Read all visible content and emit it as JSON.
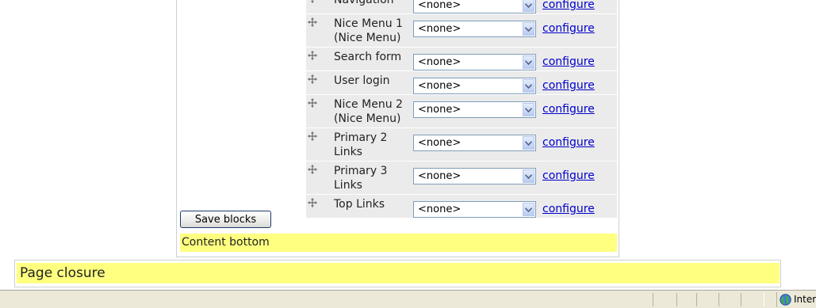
{
  "blocks": [
    {
      "name": "Navigation",
      "region": "<none>",
      "link": "configure"
    },
    {
      "name": "Nice Menu 1 (Nice Menu)",
      "region": "<none>",
      "link": "configure"
    },
    {
      "name": "Search form",
      "region": "<none>",
      "link": "configure"
    },
    {
      "name": "User login",
      "region": "<none>",
      "link": "configure"
    },
    {
      "name": "Nice Menu 2 (Nice Menu)",
      "region": "<none>",
      "link": "configure"
    },
    {
      "name": "Primary 2 Links",
      "region": "<none>",
      "link": "configure"
    },
    {
      "name": "Primary 3 Links",
      "region": "<none>",
      "link": "configure"
    },
    {
      "name": "Top Links",
      "region": "<none>",
      "link": "configure"
    }
  ],
  "save_button": "Save blocks",
  "regions": {
    "content_bottom": "Content bottom",
    "page_closure": "Page closure"
  },
  "status_bar": {
    "zone_text": "Internet",
    "zone_icon": "globe-icon"
  },
  "colors": {
    "region_highlight": "#ffff80",
    "row_background": "#ebebeb",
    "link": "#0000cc"
  }
}
